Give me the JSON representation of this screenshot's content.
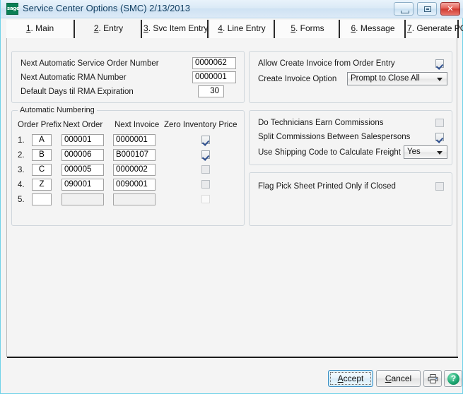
{
  "window": {
    "title": "Service Center Options (SMC) 2/13/2013",
    "app_icon": "sage-logo-icon",
    "controls": {
      "minimize": "minimize-button",
      "maximize": "maximize-button",
      "close": "close-button",
      "close_glyph": "✕"
    }
  },
  "tabs": [
    {
      "num": "1",
      "label": ". Main",
      "active": false
    },
    {
      "num": "2",
      "label": ". Entry",
      "active": true
    },
    {
      "num": "3",
      "label": ". Svc Item Entry",
      "active": false
    },
    {
      "num": "4",
      "label": ". Line Entry",
      "active": false
    },
    {
      "num": "5",
      "label": ". Forms",
      "active": false
    },
    {
      "num": "6",
      "label": ". Message",
      "active": false
    },
    {
      "num": "7",
      "label": ". Generate PO",
      "active": false
    }
  ],
  "left_top_group": {
    "fields": [
      {
        "label": "Next Automatic Service Order Number",
        "value": "0000062"
      },
      {
        "label": "Next Automatic RMA Number",
        "value": "0000001"
      },
      {
        "label": "Default Days til RMA Expiration",
        "value": "30"
      }
    ]
  },
  "auto_numbering": {
    "title": "Automatic Numbering",
    "columns": [
      "Order Prefix",
      "Next Order",
      "Next Invoice",
      "Zero Inventory Price"
    ],
    "rows": [
      {
        "num": "1.",
        "prefix": "A",
        "next_order": "000001",
        "next_invoice": "0000001",
        "zero_inv": "checked"
      },
      {
        "num": "2.",
        "prefix": "B",
        "next_order": "000006",
        "next_invoice": "B000107",
        "zero_inv": "checked"
      },
      {
        "num": "3.",
        "prefix": "C",
        "next_order": "000005",
        "next_invoice": "0000002",
        "zero_inv": "unchecked-disabled"
      },
      {
        "num": "4.",
        "prefix": "Z",
        "next_order": "090001",
        "next_invoice": "0090001",
        "zero_inv": "unchecked-disabled"
      },
      {
        "num": "5.",
        "prefix": "",
        "next_order": "",
        "next_invoice": "",
        "zero_inv": "blank"
      }
    ]
  },
  "right_top_group": {
    "allow_create_invoice_label": "Allow Create Invoice from Order Entry",
    "allow_create_invoice_state": "checked",
    "create_invoice_option_label": "Create Invoice Option",
    "create_invoice_option_value": "Prompt to Close All"
  },
  "right_mid_group": {
    "technicians_commissions_label": "Do Technicians Earn Commissions",
    "technicians_commissions_state": "unchecked-disabled",
    "split_commissions_label": "Split Commissions Between Salespersons",
    "split_commissions_state": "checked",
    "shipping_code_label": "Use Shipping Code to Calculate Freight",
    "shipping_code_value": "Yes"
  },
  "right_bottom_group": {
    "flag_pick_sheet_label": "Flag Pick Sheet Printed Only if Closed",
    "flag_pick_sheet_state": "unchecked-disabled"
  },
  "footer": {
    "accept_num": "A",
    "accept_rest": "ccept",
    "cancel_num": "C",
    "cancel_rest": "ancel",
    "print_icon": "printer-icon",
    "help_icon": "help-icon",
    "help_glyph": "?"
  },
  "colors": {
    "window_border": "#6fd2e8",
    "title_text": "#0d3b5e",
    "accent_check": "#2e4f8f",
    "sage_green": "#0a7f55",
    "close_red": "#cf3a30"
  }
}
